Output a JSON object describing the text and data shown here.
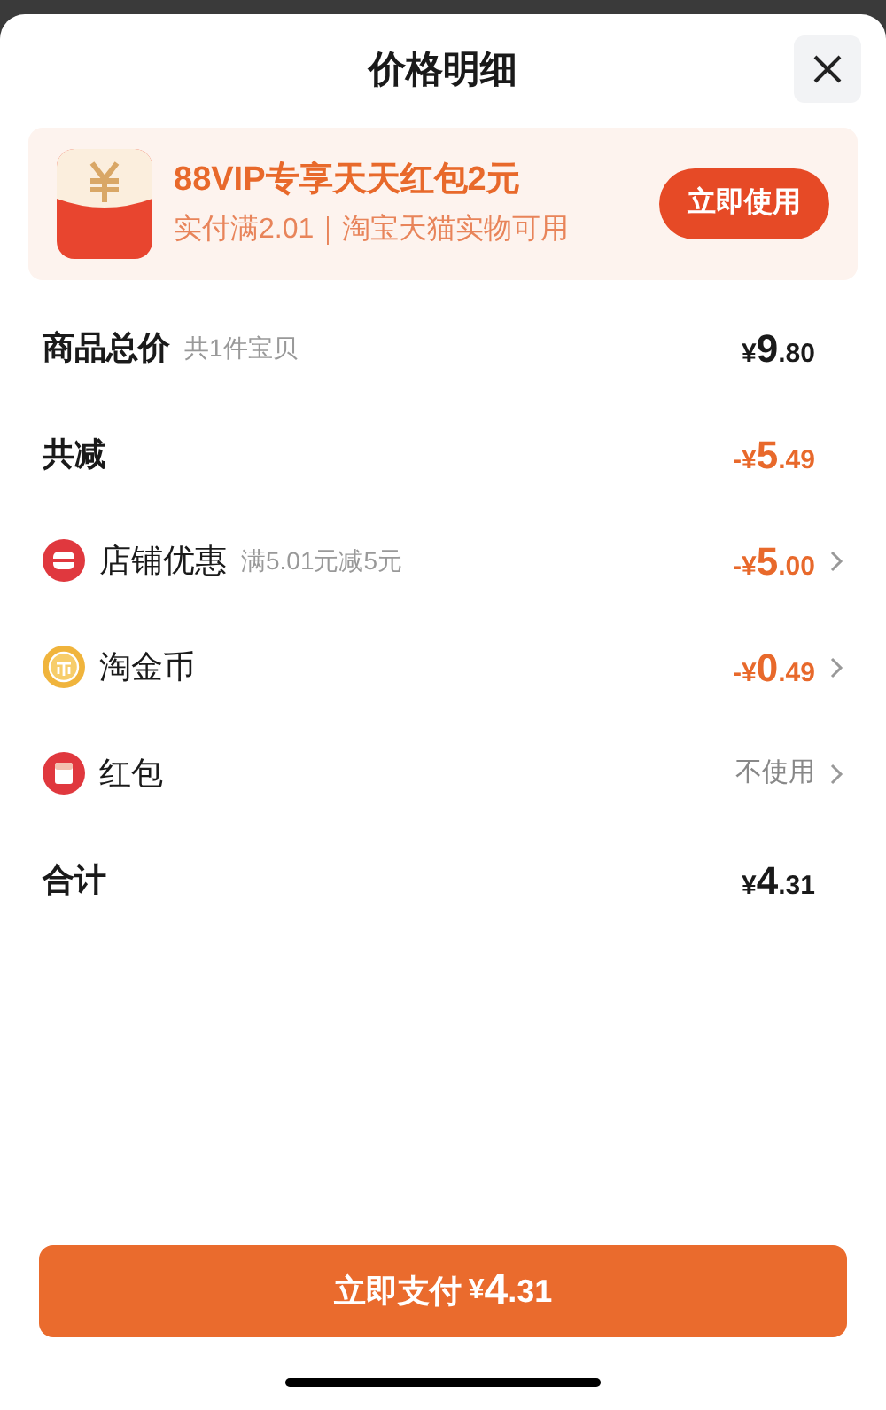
{
  "title": "价格明细",
  "promo": {
    "headline": "88VIP专享天天红包2元",
    "detail": "实付满2.01｜淘宝天猫实物可用",
    "button": "立即使用"
  },
  "rows": [
    {
      "kind": "sum",
      "label": "商品总价",
      "note": "共1件宝贝",
      "price": {
        "prefix": "¥",
        "int": "9",
        "dec": ".80"
      }
    },
    {
      "kind": "saving",
      "label": "共减",
      "price": {
        "prefix": "-¥",
        "int": "5",
        "dec": ".49"
      }
    },
    {
      "kind": "store",
      "label": "店铺优惠",
      "note": "满5.01元减5元",
      "price": {
        "prefix": "-¥",
        "int": "5",
        "dec": ".00"
      }
    },
    {
      "kind": "coins",
      "label": "淘金币",
      "price": {
        "prefix": "-¥",
        "int": "0",
        "dec": ".49"
      }
    },
    {
      "kind": "packet",
      "label": "红包",
      "value": "不使用"
    },
    {
      "kind": "sum",
      "label": "合计",
      "price": {
        "prefix": "¥",
        "int": "4",
        "dec": ".31"
      }
    }
  ],
  "pay_button": {
    "label": "立即支付",
    "price": {
      "prefix": "¥",
      "int": "4",
      "dec": ".31"
    }
  }
}
